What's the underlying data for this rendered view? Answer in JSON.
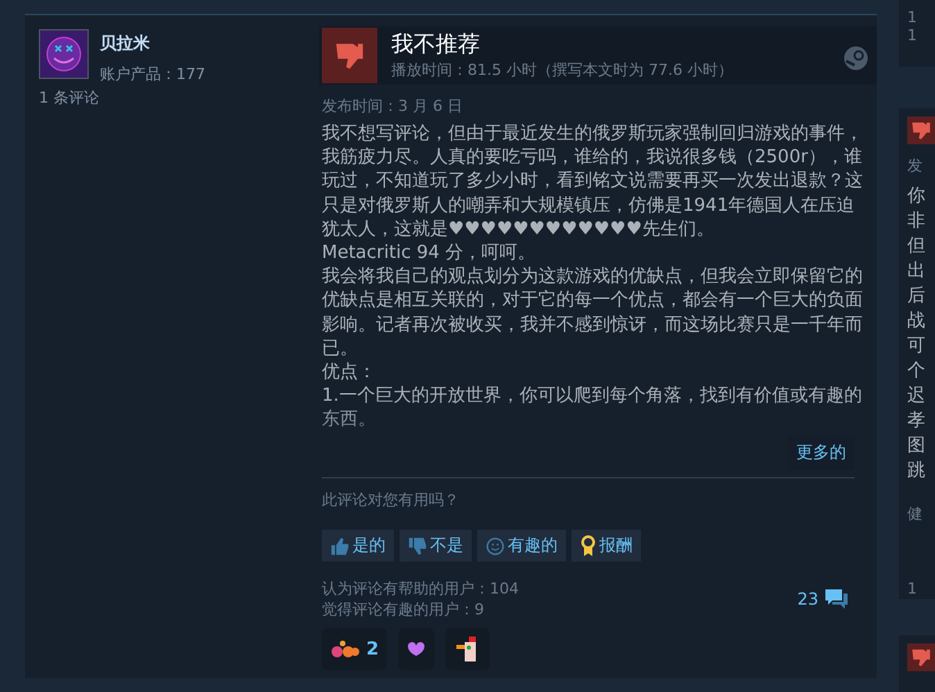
{
  "author": {
    "name": "贝拉米",
    "products": "账户产品：177",
    "reviews": "1 条评论"
  },
  "review": {
    "verdict": "我不推荐",
    "recommended": false,
    "playtime": "播放时间：81.5 小时（撰写本文时为 77.6 小时）",
    "posted": "发布时间：3 月 6 日",
    "paragraphs": [
      "我不想写评论，但由于最近发生的俄罗斯玩家强制回归游戏的事件，我筋疲力尽。人真的要吃亏吗，谁给的，我说很多钱（2500r），谁玩过，不知道玩了多少小时，看到铭文说需要再买一次发出退款？这只是对俄罗斯人的嘲弄和大规模镇压，仿佛是1941年德国人在压迫犹太人，这就是♥♥♥♥♥♥♥♥♥♥♥♥先生们。",
      "Metacritic 94 分，呵呵。",
      "我会将我自己的观点划分为这款游戏的优缺点，但我会立即保留它的优缺点是相互关联的，对于它的每一个优点，都会有一个巨大的负面影响。记者再次被收买，我并不感到惊讶，而这场比赛只是一千年而已。",
      "优点：",
      "1.一个巨大的开放世界，你可以爬到每个角落，找到有价值或有趣的东西。"
    ],
    "more": "更多的"
  },
  "feedback": {
    "question": "此评论对您有用吗？",
    "buttons": [
      {
        "kind": "yes",
        "label": "是的"
      },
      {
        "kind": "no",
        "label": "不是"
      },
      {
        "kind": "funny",
        "label": "有趣的"
      },
      {
        "kind": "award",
        "label": "报酬"
      }
    ],
    "helpful": "认为评论有帮助的用户：104",
    "funny": "觉得评论有趣的用户：9",
    "comments": "23"
  },
  "awards": [
    {
      "kind": "flowers",
      "count": "2"
    },
    {
      "kind": "hearts"
    },
    {
      "kind": "chicken"
    }
  ],
  "next_card": {
    "counts": [
      "1",
      "1"
    ],
    "posted": "发",
    "lines": [
      "你",
      "非",
      "但",
      "出",
      "后",
      "战",
      "可",
      "个",
      "迟",
      "孝",
      "图",
      "跳"
    ],
    "question": "健",
    "helpful": "1"
  }
}
